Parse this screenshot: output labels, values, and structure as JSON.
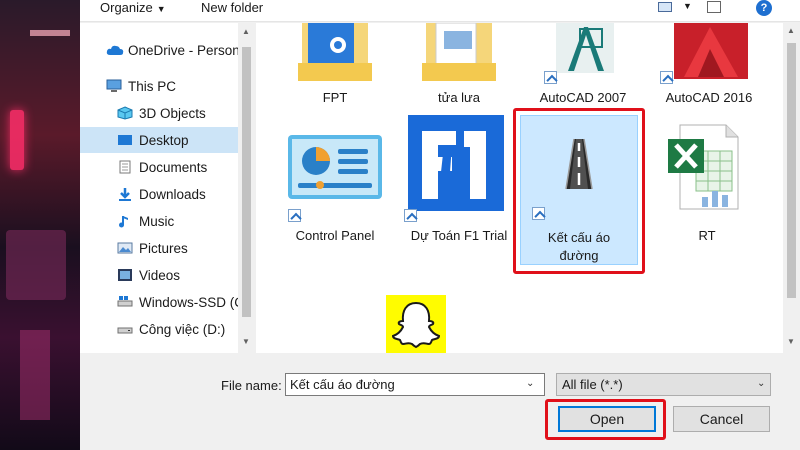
{
  "toolbar": {
    "organize_label": "Organize",
    "new_folder_label": "New folder",
    "help_label": "?"
  },
  "nav": {
    "items": [
      {
        "label": "OneDrive - Person",
        "icon": "cloud-icon"
      },
      {
        "label": "This PC",
        "icon": "computer-icon"
      },
      {
        "label": "3D Objects",
        "icon": "cube-icon"
      },
      {
        "label": "Desktop",
        "icon": "desktop-icon",
        "selected": true
      },
      {
        "label": "Documents",
        "icon": "document-icon"
      },
      {
        "label": "Downloads",
        "icon": "download-icon"
      },
      {
        "label": "Music",
        "icon": "music-icon"
      },
      {
        "label": "Pictures",
        "icon": "pictures-icon"
      },
      {
        "label": "Videos",
        "icon": "video-icon"
      },
      {
        "label": "Windows-SSD (C",
        "icon": "drive-icon"
      },
      {
        "label": "Công việc (D:)",
        "icon": "drive-icon"
      }
    ]
  },
  "files": {
    "items": [
      {
        "label": "FPT",
        "icon": "folder-icon"
      },
      {
        "label": "tửa lưa",
        "icon": "folder-icon"
      },
      {
        "label": "AutoCAD 2007",
        "icon": "autocad-icon",
        "shortcut": true
      },
      {
        "label": "AutoCAD 2016",
        "icon": "autocad-red-icon",
        "shortcut": true
      },
      {
        "label": "Control Panel",
        "icon": "control-panel-icon",
        "shortcut": true
      },
      {
        "label": "Dự Toán F1 Trial",
        "icon": "f1-icon",
        "shortcut": true
      },
      {
        "label": "Kết cấu áo đường",
        "label_line1": "Kết cấu áo",
        "label_line2": "đường",
        "icon": "road-icon",
        "shortcut": true,
        "selected": true
      },
      {
        "label": "RT",
        "icon": "excel-icon"
      },
      {
        "label": "",
        "icon": "snapchat-icon"
      }
    ]
  },
  "footer": {
    "file_name_label": "File name:",
    "file_name_value": "Kết cấu áo đường",
    "filter_value": "All file (*.*)",
    "open_label": "Open",
    "cancel_label": "Cancel"
  },
  "colors": {
    "selection": "#cce8ff",
    "highlight_box": "#e0101a",
    "accent": "#0078d7"
  }
}
